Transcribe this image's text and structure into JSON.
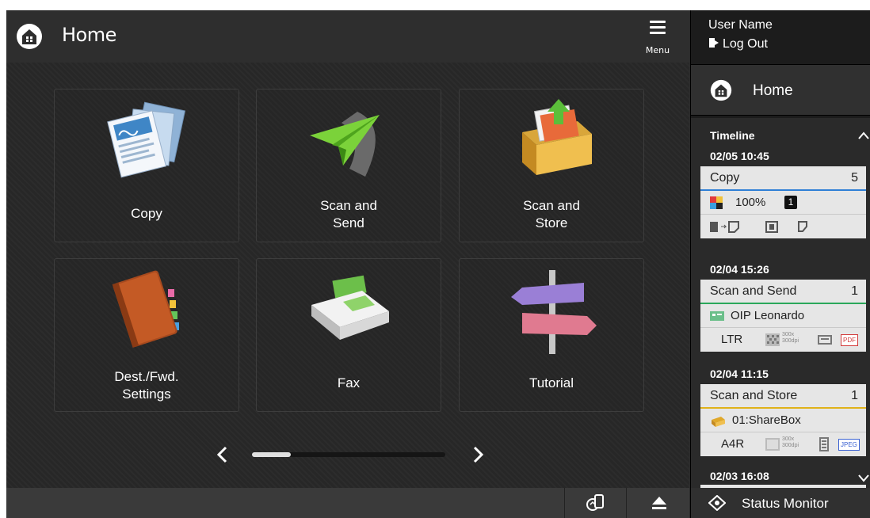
{
  "header": {
    "title": "Home",
    "menu_label": "Menu"
  },
  "tiles": [
    {
      "label": "Copy",
      "icon": "copy-icon"
    },
    {
      "label": "Scan and\nSend",
      "icon": "paper-plane-icon"
    },
    {
      "label": "Scan and\nStore",
      "icon": "storage-box-icon"
    },
    {
      "label": "Dest./Fwd.\nSettings",
      "icon": "address-book-icon"
    },
    {
      "label": "Fax",
      "icon": "fax-icon"
    },
    {
      "label": "Tutorial",
      "icon": "signpost-icon"
    }
  ],
  "pager": {
    "current_page": 1,
    "total_pages": 5
  },
  "side": {
    "user_name": "User Name",
    "logout_label": "Log Out",
    "home_label": "Home",
    "timeline_title": "Timeline",
    "jobs": [
      {
        "date": "02/05 10:45",
        "title": "Copy",
        "count": "5",
        "accent": "#2f7fd6",
        "row1": {
          "zoom": "100%",
          "copies": "1"
        }
      },
      {
        "date": "02/04 15:26",
        "title": "Scan and Send",
        "count": "1",
        "accent": "#2aa85a",
        "row1": {
          "dest": "OIP Leonardo"
        },
        "row2": {
          "size": "LTR",
          "res": "300x\n300dpi",
          "format": "PDF"
        }
      },
      {
        "date": "02/04 11:15",
        "title": "Scan and Store",
        "count": "1",
        "accent": "#e0b21a",
        "row1": {
          "dest": "01:ShareBox"
        },
        "row2": {
          "size": "A4R",
          "res": "300x\n300dpi",
          "format": "JPEG"
        }
      },
      {
        "date": "02/03 16:08"
      }
    ],
    "status_monitor_label": "Status Monitor"
  }
}
